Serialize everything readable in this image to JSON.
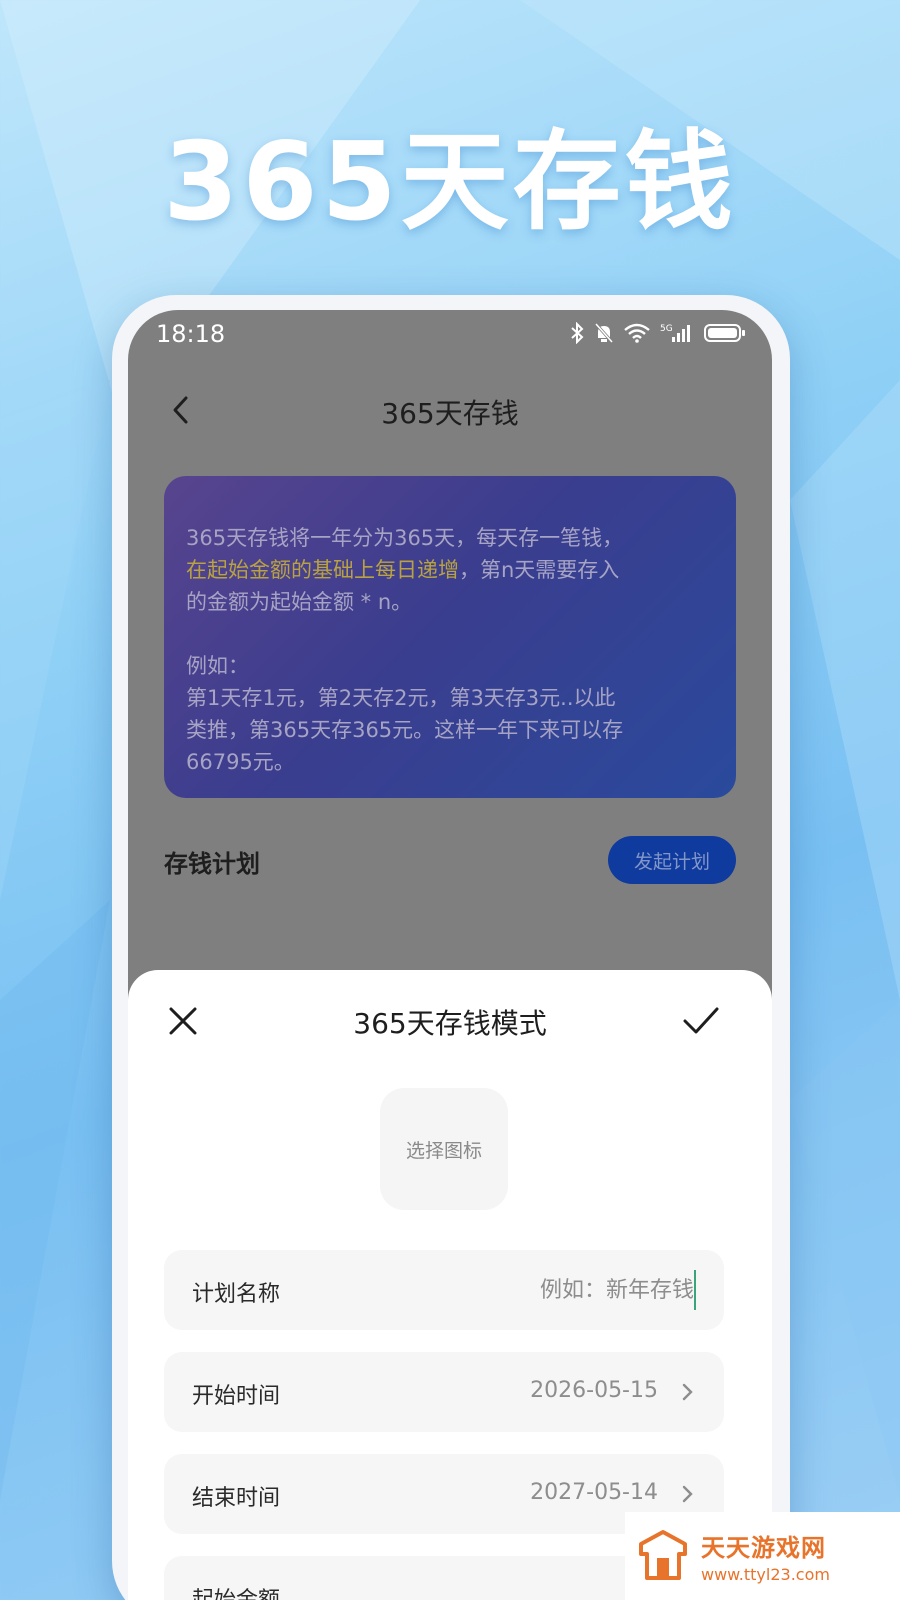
{
  "headline": "365天存钱",
  "status_bar": {
    "time": "18:18",
    "network": "5G"
  },
  "nav": {
    "title": "365天存钱"
  },
  "intro": {
    "line1": "365天存钱将一年分为365天，每天存一笔钱，",
    "highlight": "在起始金额的基础上每日递增",
    "line2_rest": "，第n天需要存入",
    "line3": "的金额为起始金额 * n。",
    "example_label": "例如：",
    "example_line1": "第1天存1元，第2天存2元，第3天存3元..以此",
    "example_line2": "类推，第365天存365元。这样一年下来可以存",
    "example_line3": "66795元。"
  },
  "plan_section": {
    "title": "存钱计划",
    "start_button": "发起计划"
  },
  "sheet": {
    "title": "365天存钱模式",
    "icon_picker_label": "选择图标",
    "fields": {
      "plan_name": {
        "label": "计划名称",
        "placeholder": "例如：新年存钱"
      },
      "start_date": {
        "label": "开始时间",
        "value": "2026-05-15"
      },
      "end_date": {
        "label": "结束时间",
        "value": "2027-05-14"
      },
      "start_amount": {
        "label": "起始金额"
      }
    }
  },
  "watermark": {
    "title": "天天游戏网",
    "url": "www.ttyl23.com"
  },
  "colors": {
    "background": "#8fd0f6",
    "intro_card": "#3b3d8e",
    "highlight_text": "#b9a240",
    "start_button": "#0f3a9e",
    "watermark": "#e8732a"
  }
}
